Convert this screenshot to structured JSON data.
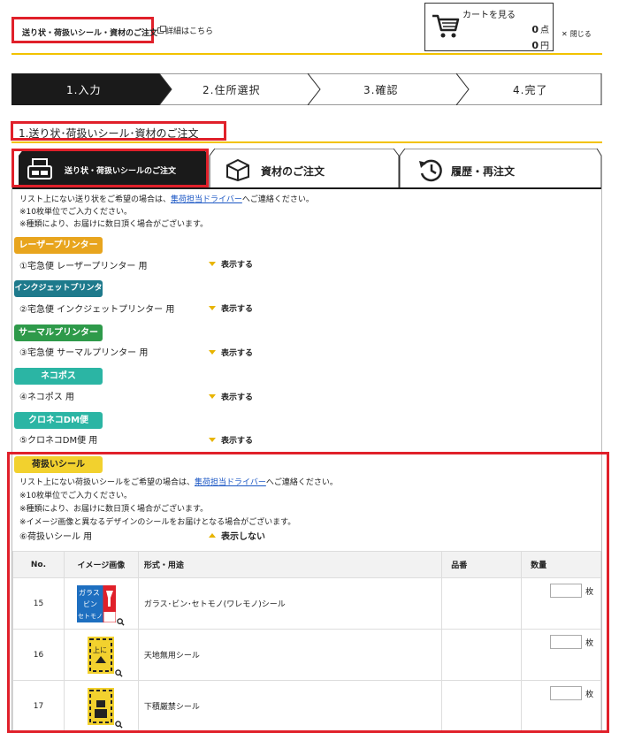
{
  "header": {
    "title": "送り状・荷扱いシール・資材のご注文",
    "detail_link": "詳細はこちら",
    "cart": {
      "label": "カートを見る",
      "count": "0",
      "count_unit": "点",
      "amount": "0",
      "amount_unit": "円"
    },
    "close_label": "閉じる"
  },
  "steps": [
    {
      "label": "1.入力",
      "active": true
    },
    {
      "label": "2.住所選択",
      "active": false
    },
    {
      "label": "3.確認",
      "active": false
    },
    {
      "label": "4.完了",
      "active": false
    }
  ],
  "section_title": "1.送り状･荷扱いシール･資材のご注文",
  "tabs": [
    {
      "label": "送り状・荷扱いシールのご注文",
      "icon": "printer-label-icon",
      "active": true
    },
    {
      "label": "資材のご注文",
      "icon": "box-icon",
      "active": false
    },
    {
      "label": "履歴・再注文",
      "icon": "history-icon",
      "active": false
    }
  ],
  "intro": {
    "line1_pre": "リスト上にない送り状をご希望の場合は、",
    "line1_link": "集荷担当ドライバー",
    "line1_post": "へご連絡ください。",
    "line2": "※10枚単位でご入力ください。",
    "line3": "※種類により、お届けに数日頂く場合がございます。"
  },
  "categories": [
    {
      "badge": "レーザープリンター",
      "color": "#e8a51e",
      "item": "①宅急便 レーザープリンター 用",
      "toggle": "表示する"
    },
    {
      "badge": "インクジェットプリンター",
      "color": "#1e7a8c",
      "item": "②宅急便 インクジェットプリンター 用",
      "toggle": "表示する"
    },
    {
      "badge": "サーマルプリンター",
      "color": "#2e9a4a",
      "item": "③宅急便 サーマルプリンター 用",
      "toggle": "表示する"
    },
    {
      "badge": "ネコポス",
      "color": "#2bb5a4",
      "item": "④ネコポス 用",
      "toggle": "表示する"
    },
    {
      "badge": "クロネコDM便",
      "color": "#2bb5a4",
      "item": "⑤クロネコDM便 用",
      "toggle": "表示する"
    }
  ],
  "handling": {
    "badge": "荷扱いシール",
    "badge_color": "#f2d12e",
    "line1_pre": "リスト上にない荷扱いシールをご希望の場合は、",
    "line1_link": "集荷担当ドライバー",
    "line1_post": "へご連絡ください。",
    "line2": "※10枚単位でご入力ください。",
    "line3": "※種類により、お届けに数日頂く場合がございます。",
    "line4": "※イメージ画像と異なるデザインのシールをお届けとなる場合がございます。",
    "item": "⑥荷扱いシール 用",
    "toggle": "表示しない"
  },
  "table": {
    "headers": {
      "no": "No.",
      "image": "イメージ画像",
      "format": "形式・用途",
      "code": "品番",
      "qty": "数量"
    },
    "rows": [
      {
        "no": "15",
        "format": "ガラス･ビン･セトモノ(ワレモノ)シール",
        "unit": "枚",
        "image": "glass-fragile-sticker"
      },
      {
        "no": "16",
        "format": "天地無用シール",
        "unit": "枚",
        "image": "this-side-up-sticker"
      },
      {
        "no": "17",
        "format": "下積厳禁シール",
        "unit": "枚",
        "image": "do-not-stack-sticker"
      }
    ]
  },
  "colors": {
    "accent_yellow": "#f2c200",
    "highlight_red": "#e0202a",
    "dark": "#1a1a1a",
    "link": "#1a56c4"
  }
}
